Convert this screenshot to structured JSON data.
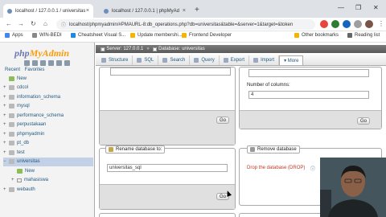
{
  "browser": {
    "tabs": [
      {
        "title": "localhost / 127.0.0.1 / universitas"
      },
      {
        "title": "localhost / 127.0.0.1 | phpMyAd"
      }
    ],
    "address": "localhost/phpmyadmin/#PMAURL-8:db_operations.php?db=universitas&table=&server=1&target=&token",
    "bookmarks": [
      "Apps",
      "WIN-BEDI",
      "Cheatsheet Visual S...",
      "Update membershi...",
      "Frontend Developer"
    ],
    "other_bookmarks": "Other bookmarks",
    "reading_list": "Reading list"
  },
  "sidebar": {
    "logo_php": "php",
    "logo_admin": "MyAdmin",
    "recent": "Recent",
    "favorites": "Favorites",
    "databases": [
      {
        "name": "New",
        "expander": ""
      },
      {
        "name": "cdcol",
        "expander": "+"
      },
      {
        "name": "information_schema",
        "expander": "+"
      },
      {
        "name": "mysql",
        "expander": "+"
      },
      {
        "name": "performance_schema",
        "expander": "+"
      },
      {
        "name": "perpustakaan",
        "expander": "+"
      },
      {
        "name": "phpmyadmin",
        "expander": "+"
      },
      {
        "name": "pt_db",
        "expander": "+"
      },
      {
        "name": "test",
        "expander": "+"
      },
      {
        "name": "universitas",
        "expander": "−"
      },
      {
        "name": "New",
        "expander": ""
      },
      {
        "name": "mahasiswa",
        "expander": "+"
      },
      {
        "name": "webauth",
        "expander": "+"
      }
    ]
  },
  "main": {
    "server_crumb": "Server: 127.0.0.1",
    "database_crumb": "Database: universitas",
    "tabs": [
      "Structure",
      "SQL",
      "Search",
      "Query",
      "Export",
      "Import",
      "More"
    ],
    "columns_label": "Number of columns:",
    "columns_value": "4",
    "go": "Go",
    "rename_legend": "Rename database to:",
    "rename_value": "universitas_sql",
    "remove_legend": "Remove database",
    "drop_link": "Drop the database (DROP)"
  }
}
